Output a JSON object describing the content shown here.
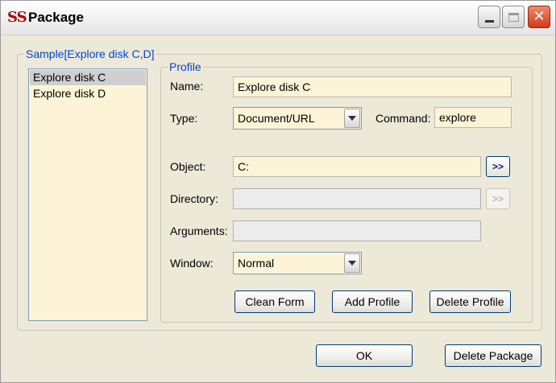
{
  "window": {
    "app_logo": "SS",
    "title": "Package",
    "controls": {
      "minimize": "minimize",
      "maximize": "maximize",
      "close": "✕"
    }
  },
  "package_group": {
    "legend": "Sample[Explore disk C,D]",
    "profiles": [
      {
        "label": "Explore disk C",
        "selected": true
      },
      {
        "label": "Explore disk D",
        "selected": false
      }
    ]
  },
  "profile": {
    "legend": "Profile",
    "name_label": "Name:",
    "name_value": "Explore disk C",
    "type_label": "Type:",
    "type_value": "Document/URL",
    "command_label": "Command:",
    "command_value": "explore",
    "object_label": "Object:",
    "object_value": "C:",
    "object_browse": ">>",
    "directory_label": "Directory:",
    "directory_value": "",
    "directory_browse": ">>",
    "arguments_label": "Arguments:",
    "arguments_value": "",
    "window_label": "Window:",
    "window_value": "Normal",
    "clean_form": "Clean Form",
    "add_profile": "Add Profile",
    "delete_profile": "Delete Profile"
  },
  "footer": {
    "ok": "OK",
    "delete_package": "Delete Package"
  },
  "colors": {
    "field_bg": "#fdf4d7",
    "legend_text": "#0046d5",
    "close_button": "#d23a1a"
  }
}
